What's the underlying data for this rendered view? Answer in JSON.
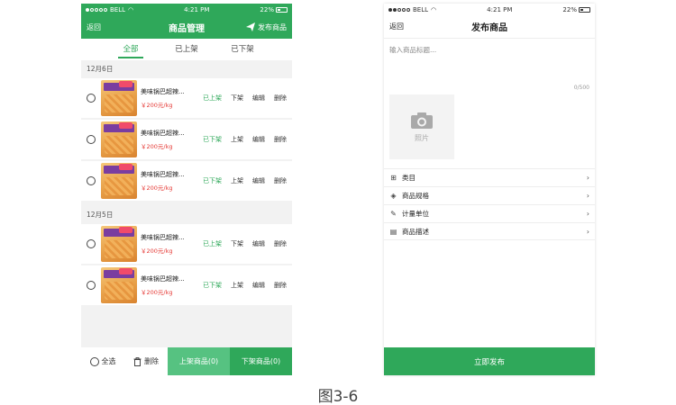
{
  "left": {
    "status": {
      "carrier": "BELL",
      "time": "4:21 PM",
      "battery": "22%"
    },
    "nav": {
      "back": "返回",
      "title": "商品管理",
      "action": "发布商品"
    },
    "tabs": [
      "全部",
      "已上架",
      "已下架"
    ],
    "groups": [
      {
        "date": "12月6日",
        "items": [
          {
            "name": "美味锅巴超辣...",
            "price": "￥200元/kg",
            "status": "已上架",
            "toggle": "下架",
            "edit": "编辑",
            "delete": "删除"
          },
          {
            "name": "美味锅巴超辣...",
            "price": "￥200元/kg",
            "status": "已下架",
            "toggle": "上架",
            "edit": "编辑",
            "delete": "删除"
          },
          {
            "name": "美味锅巴超辣...",
            "price": "￥200元/kg",
            "status": "已下架",
            "toggle": "上架",
            "edit": "编辑",
            "delete": "删除"
          }
        ]
      },
      {
        "date": "12月5日",
        "items": [
          {
            "name": "美味锅巴超辣...",
            "price": "￥200元/kg",
            "status": "已上架",
            "toggle": "下架",
            "edit": "编辑",
            "delete": "删除"
          },
          {
            "name": "美味锅巴超辣...",
            "price": "￥200元/kg",
            "status": "已下架",
            "toggle": "上架",
            "edit": "编辑",
            "delete": "删除"
          }
        ]
      }
    ],
    "bottom": {
      "select_all": "全选",
      "delete": "删除",
      "list_on": "上架商品(0)",
      "list_off": "下架商品(0)"
    }
  },
  "right": {
    "status": {
      "carrier": "BELL",
      "time": "4:21 PM",
      "battery": "22%"
    },
    "nav": {
      "back": "返回",
      "title": "发布商品"
    },
    "title_placeholder": "输入商品标题...",
    "counter": "0/500",
    "photo_label": "照片",
    "menu": [
      {
        "label": "类目",
        "icon": "grid-icon"
      },
      {
        "label": "商品规格",
        "icon": "layers-icon"
      },
      {
        "label": "计量单位",
        "icon": "pencil-icon"
      },
      {
        "label": "商品描述",
        "icon": "document-icon"
      }
    ],
    "publish": "立即发布"
  },
  "caption": "图3-6",
  "colors": {
    "primary": "#2fa85a",
    "primary_light": "#56c281",
    "price": "#e53935"
  }
}
